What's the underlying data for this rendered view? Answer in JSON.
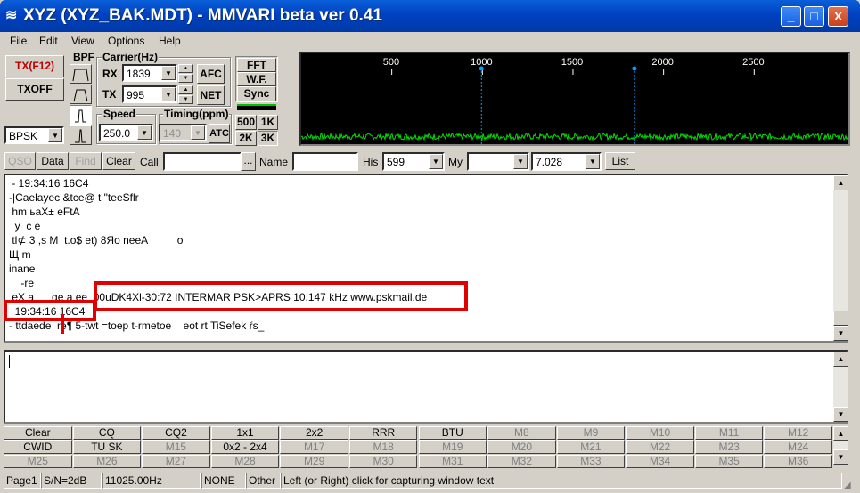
{
  "window": {
    "icon": "signal-icon",
    "title": "XYZ (XYZ_BAK.MDT) - MMVARI beta ver 0.41",
    "min_glyph": "_",
    "max_glyph": "□",
    "close_glyph": "X"
  },
  "menu": [
    "File",
    "Edit",
    "View",
    "Options",
    "Help"
  ],
  "left_controls": {
    "tx_label": "TX(F12)",
    "txoff_label": "TXOFF",
    "mode_value": "BPSK",
    "bpf_label": "BPF"
  },
  "carrier": {
    "label": "Carrier(Hz)",
    "rx_label": "RX",
    "rx_value": "1839",
    "tx_label": "TX",
    "tx_value": "995",
    "afc_label": "AFC",
    "net_label": "NET"
  },
  "speed": {
    "label": "Speed",
    "value": "250.0"
  },
  "timing": {
    "label": "Timing(ppm)",
    "value": "140",
    "atc_label": "ATC"
  },
  "view_buttons": {
    "fft": "FFT",
    "wf": "W.F.",
    "sync": "Sync",
    "b500": "500",
    "b1k": "1K",
    "b2k": "2K",
    "b3k": "3K"
  },
  "spectrum": {
    "ticks": [
      "500",
      "1000",
      "1500",
      "2000",
      "2500"
    ],
    "rx_marker_hz": 1839,
    "tx_marker_hz": 995,
    "accent_color": "#00a0ff"
  },
  "toolbar": {
    "qso": "QSO",
    "data": "Data",
    "find": "Find",
    "clear": "Clear",
    "call_label": "Call",
    "call_value": "",
    "browse": "...",
    "name_label": "Name",
    "name_value": "",
    "his_label": "His",
    "his_value": "599",
    "my_label": "My",
    "my_value": "",
    "freq_value": "7.028",
    "list": "List"
  },
  "rx_lines": [
    " - 19:34:16 16C4",
    "-|Caelayec &tce@ t \"teeSflr",
    " hm ьaX± eFtA",
    "  y  c e",
    " tl⊄ 3 ,s M  t.o$ et) 8Яo neeA          o",
    "Щ m",
    "inane",
    "    -re",
    " eX a      ge a ee  00uDK4Xl-30:72 INTERMAR PSK>APRS 10.147 kHz www.pskmail.de",
    "  19:34:16 16C4",
    "- ttdaede  re¶ 5-twt =toep t-rmetoe    eot rt TiSefek ŕs_"
  ],
  "macros": [
    [
      "Clear",
      "CQ",
      "CQ2",
      "1x1",
      "2x2",
      "RRR",
      "BTU",
      "M8",
      "M9",
      "M10",
      "M11",
      "M12"
    ],
    [
      "CWID",
      "TU SK",
      "M15",
      "0x2 - 2x4",
      "M17",
      "M18",
      "M19",
      "M20",
      "M21",
      "M22",
      "M23",
      "M24"
    ],
    [
      "M25",
      "M26",
      "M27",
      "M28",
      "M29",
      "M30",
      "M31",
      "M32",
      "M33",
      "M34",
      "M35",
      "M36"
    ]
  ],
  "status": {
    "page": "Page1",
    "sn": "S/N=2dB",
    "clock": "11025.00Hz",
    "mode": "NONE",
    "other": "Other",
    "hint": "Left (or Right) click for capturing window text"
  }
}
